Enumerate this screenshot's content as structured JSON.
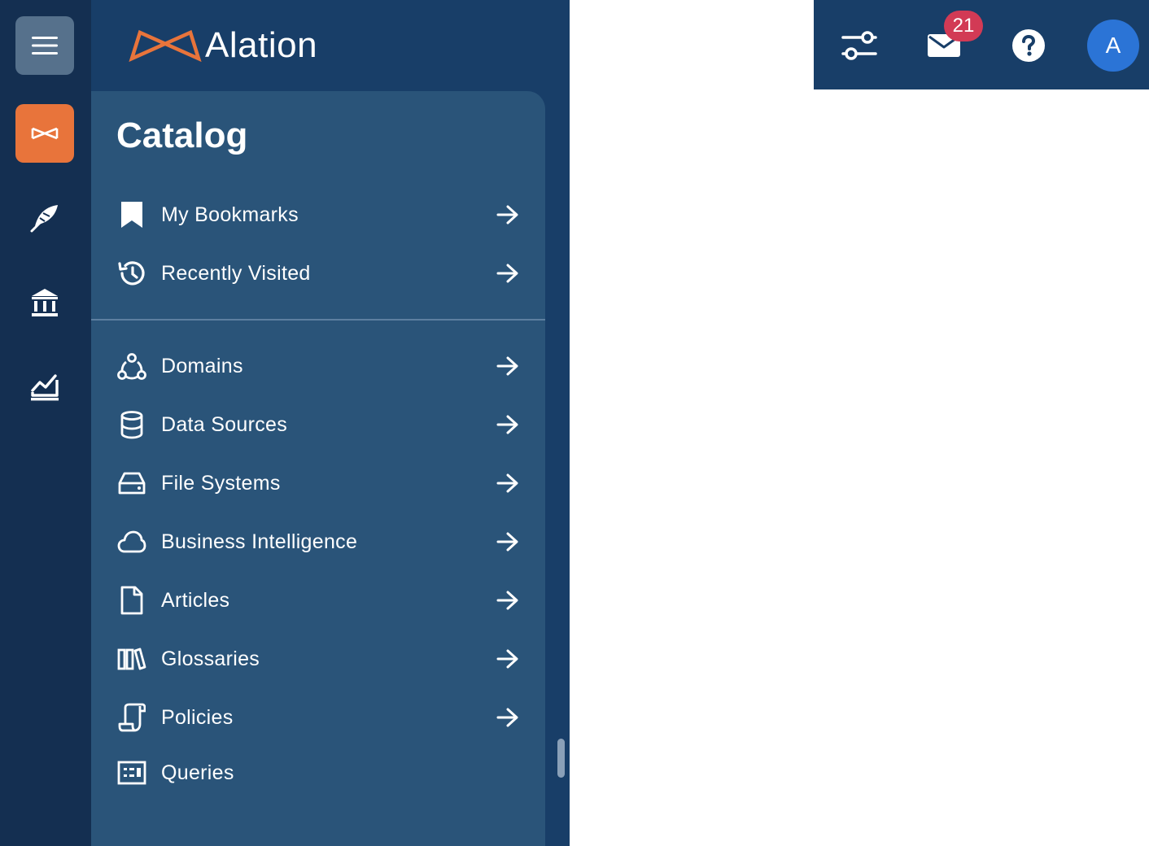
{
  "app": {
    "logo_text": "Alation"
  },
  "rail": {
    "items": [
      {
        "name": "menu",
        "icon": "hamburger-icon"
      },
      {
        "name": "catalog",
        "icon": "alation-logo-icon",
        "active_color": "#e8743b"
      },
      {
        "name": "compose",
        "icon": "feather-icon"
      },
      {
        "name": "governance",
        "icon": "bank-icon"
      },
      {
        "name": "analytics",
        "icon": "chart-icon"
      }
    ]
  },
  "catalog": {
    "title": "Catalog",
    "top_items": [
      {
        "label": "My Bookmarks",
        "icon": "bookmark-icon"
      },
      {
        "label": "Recently Visited",
        "icon": "history-icon"
      }
    ],
    "items": [
      {
        "label": "Domains",
        "icon": "domains-icon"
      },
      {
        "label": "Data Sources",
        "icon": "database-icon"
      },
      {
        "label": "File Systems",
        "icon": "hard-drive-icon"
      },
      {
        "label": "Business Intelligence",
        "icon": "cloud-icon"
      },
      {
        "label": "Articles",
        "icon": "file-icon"
      },
      {
        "label": "Glossaries",
        "icon": "books-icon"
      },
      {
        "label": "Policies",
        "icon": "scroll-icon"
      },
      {
        "label": "Queries",
        "icon": "query-icon"
      }
    ]
  },
  "topbar": {
    "notifications_count": "21",
    "avatar_initial": "A"
  },
  "colors": {
    "rail_bg": "#142f51",
    "panel_bg": "#183e68",
    "card_bg": "#2a5479",
    "accent": "#e8743b",
    "badge": "#d23a55",
    "avatar": "#2b74d6"
  }
}
